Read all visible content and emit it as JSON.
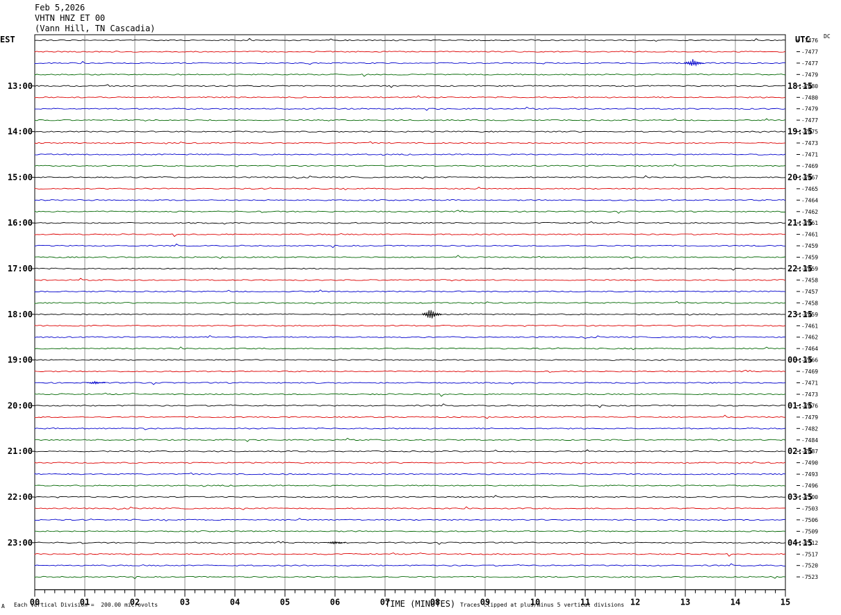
{
  "header": {
    "date": "Feb 5,2026",
    "station": "VHTN HNZ ET 00",
    "location": "(Vann Hill, TN Cascadia)"
  },
  "labels": {
    "left_timezone": "EST",
    "right_timezone": "UTC",
    "dc": "DC"
  },
  "footer": {
    "scale": "Each Vertical Division =  200.00 microvolts",
    "clip": "Traces clipped at plus/minus 5 vertical divisions",
    "mark": "A"
  },
  "chart_data": {
    "type": "line",
    "title": "",
    "xlabel": "TIME (MINUTES)",
    "x_ticks": [
      "00",
      "01",
      "02",
      "03",
      "04",
      "05",
      "06",
      "07",
      "08",
      "09",
      "10",
      "11",
      "12",
      "13",
      "14",
      "15"
    ],
    "xlim": [
      0,
      15
    ],
    "left_time_labels": [
      "13:00",
      "14:00",
      "15:00",
      "16:00",
      "17:00",
      "18:00",
      "19:00",
      "20:00",
      "21:00",
      "22:00",
      "23:00"
    ],
    "right_time_labels": [
      "18:15",
      "19:15",
      "20:15",
      "21:15",
      "22:15",
      "23:15",
      "00:15",
      "01:15",
      "02:15",
      "03:15",
      "04:15"
    ],
    "trace_colors": [
      "#000000",
      "#dd0000",
      "#0000cc",
      "#006600"
    ],
    "dc_offsets": [
      "-7476",
      "-7477",
      "-7477",
      "-7479",
      "-7480",
      "-7480",
      "-7479",
      "-7477",
      "-7475",
      "-7473",
      "-7471",
      "-7469",
      "-7467",
      "-7465",
      "-7464",
      "-7462",
      "-7461",
      "-7461",
      "-7459",
      "-7459",
      "-7459",
      "-7458",
      "-7457",
      "-7458",
      "-7459",
      "-7461",
      "-7462",
      "-7464",
      "-7466",
      "-7469",
      "-7471",
      "-7473",
      "-7476",
      "-7479",
      "-7482",
      "-7484",
      "-7487",
      "-7490",
      "-7493",
      "-7496",
      "-7500",
      "-7503",
      "-7506",
      "-7509",
      "-7512",
      "-7517",
      "-7520",
      "-7523"
    ],
    "events": [
      {
        "trace": 2,
        "minute": 13.15,
        "amplitude": "large"
      },
      {
        "trace": 24,
        "minute": 7.92,
        "amplitude": "spike"
      },
      {
        "trace": 44,
        "minute": 6.0,
        "amplitude": "small"
      },
      {
        "trace": 30,
        "minute": 1.2,
        "amplitude": "small"
      }
    ]
  }
}
